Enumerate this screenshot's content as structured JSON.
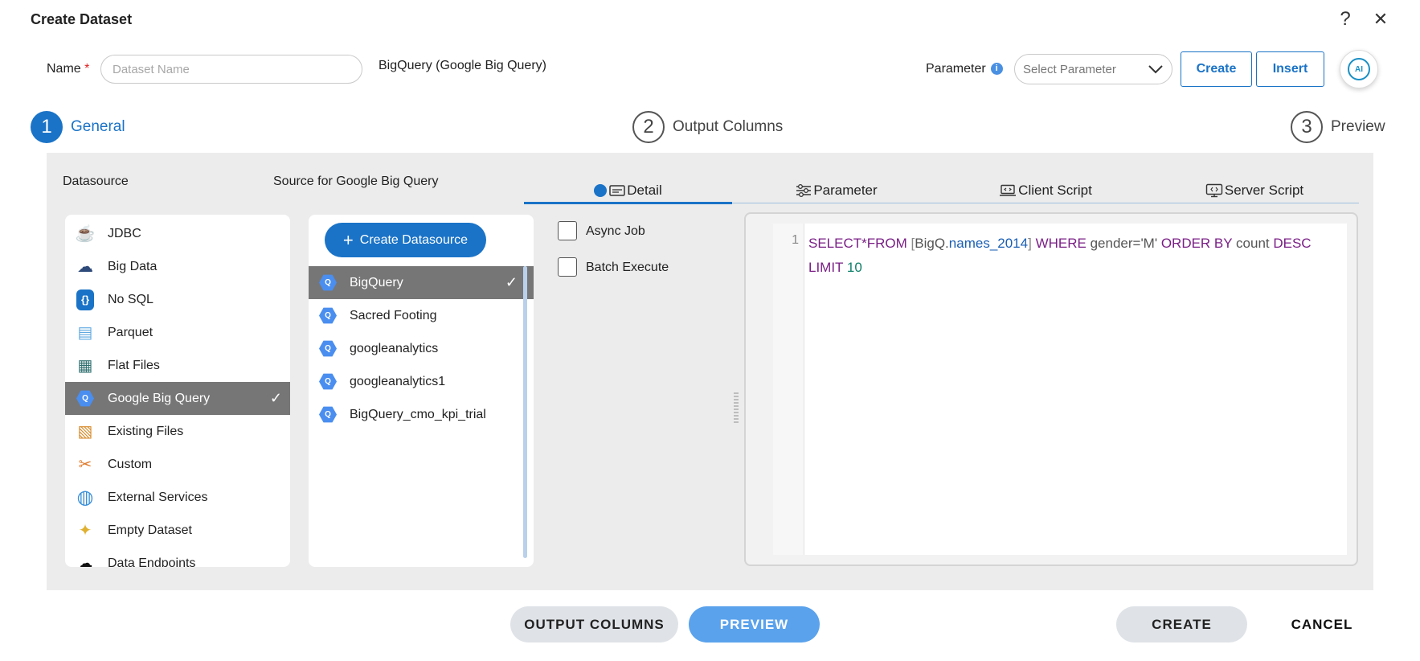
{
  "dialog": {
    "title": "Create Dataset"
  },
  "header": {
    "name_label": "Name",
    "required_mark": "*",
    "name_placeholder": "Dataset Name",
    "name_value": "",
    "datasource_label": "BigQuery (Google Big Query)",
    "parameter_label": "Parameter",
    "parameter_select_placeholder": "Select Parameter",
    "create_button": "Create",
    "insert_button": "Insert",
    "ai_label": "AI",
    "help_symbol": "?",
    "close_symbol": "✕"
  },
  "steps": [
    {
      "number": "1",
      "label": "General",
      "active": true
    },
    {
      "number": "2",
      "label": "Output Columns",
      "active": false
    },
    {
      "number": "3",
      "label": "Preview",
      "active": false
    }
  ],
  "columns": {
    "datasource_heading": "Datasource",
    "source_heading": "Source for Google Big Query"
  },
  "tabs": [
    {
      "label": "Detail",
      "icon": "detail-icon",
      "active": true
    },
    {
      "label": "Parameter",
      "icon": "sliders-icon",
      "active": false
    },
    {
      "label": "Client Script",
      "icon": "laptop-code-icon",
      "active": false
    },
    {
      "label": "Server Script",
      "icon": "monitor-code-icon",
      "active": false
    }
  ],
  "datasources": [
    {
      "label": "JDBC",
      "icon": "jdbc-icon",
      "glyph": "☕",
      "color": "#c9a227"
    },
    {
      "label": "Big Data",
      "icon": "big-data-icon",
      "glyph": "☁",
      "color": "#2e4a7a"
    },
    {
      "label": "No SQL",
      "icon": "nosql-icon",
      "glyph": "{}",
      "color": "#1a73c7"
    },
    {
      "label": "Parquet",
      "icon": "parquet-icon",
      "glyph": "▤",
      "color": "#5fa9e0"
    },
    {
      "label": "Flat Files",
      "icon": "flat-files-icon",
      "glyph": "▦",
      "color": "#2f6f6f"
    },
    {
      "label": "Google Big Query",
      "icon": "google-big-query-icon",
      "glyph": "Q",
      "color": "#4a8ef0",
      "selected": true
    },
    {
      "label": "Existing Files",
      "icon": "existing-files-icon",
      "glyph": "▧",
      "color": "#d68a2a"
    },
    {
      "label": "Custom",
      "icon": "custom-tools-icon",
      "glyph": "✂",
      "color": "#e07a2a"
    },
    {
      "label": "External Services",
      "icon": "globe-icon",
      "glyph": "◍",
      "color": "#3a8fd8"
    },
    {
      "label": "Empty Dataset",
      "icon": "empty-dataset-icon",
      "glyph": "✦",
      "color": "#e0b030"
    },
    {
      "label": "Data Endpoints",
      "icon": "api-cloud-icon",
      "glyph": "☁",
      "color": "#111"
    }
  ],
  "source_panel": {
    "create_button": "Create Datasource"
  },
  "sources": [
    {
      "label": "BigQuery",
      "selected": true
    },
    {
      "label": "Sacred Footing"
    },
    {
      "label": "googleanalytics"
    },
    {
      "label": "googleanalytics1"
    },
    {
      "label": "BigQuery_cmo_kpi_trial"
    }
  ],
  "options": {
    "async_job": "Async Job",
    "batch_execute": "Batch Execute",
    "async_checked": false,
    "batch_checked": false
  },
  "editor": {
    "line_number": "1",
    "tokens_line1": [
      {
        "t": "SELECT*FROM ",
        "c": "kw"
      },
      {
        "t": "[",
        "c": "br"
      },
      {
        "t": "BigQ.",
        "c": "pl"
      },
      {
        "t": "names_2014",
        "c": "id"
      },
      {
        "t": "]",
        "c": "br"
      },
      {
        "t": " WHERE ",
        "c": "kw"
      },
      {
        "t": "gender='M'",
        "c": "pl"
      },
      {
        "t": " ORDER BY ",
        "c": "kw"
      },
      {
        "t": "count",
        "c": "pl"
      },
      {
        "t": " DESC",
        "c": "kw"
      }
    ],
    "tokens_line2": [
      {
        "t": "LIMIT ",
        "c": "kw"
      },
      {
        "t": "10",
        "c": "num"
      }
    ]
  },
  "footer": {
    "output_columns": "OUTPUT COLUMNS",
    "preview": "PREVIEW",
    "create": "CREATE",
    "cancel": "CANCEL"
  }
}
